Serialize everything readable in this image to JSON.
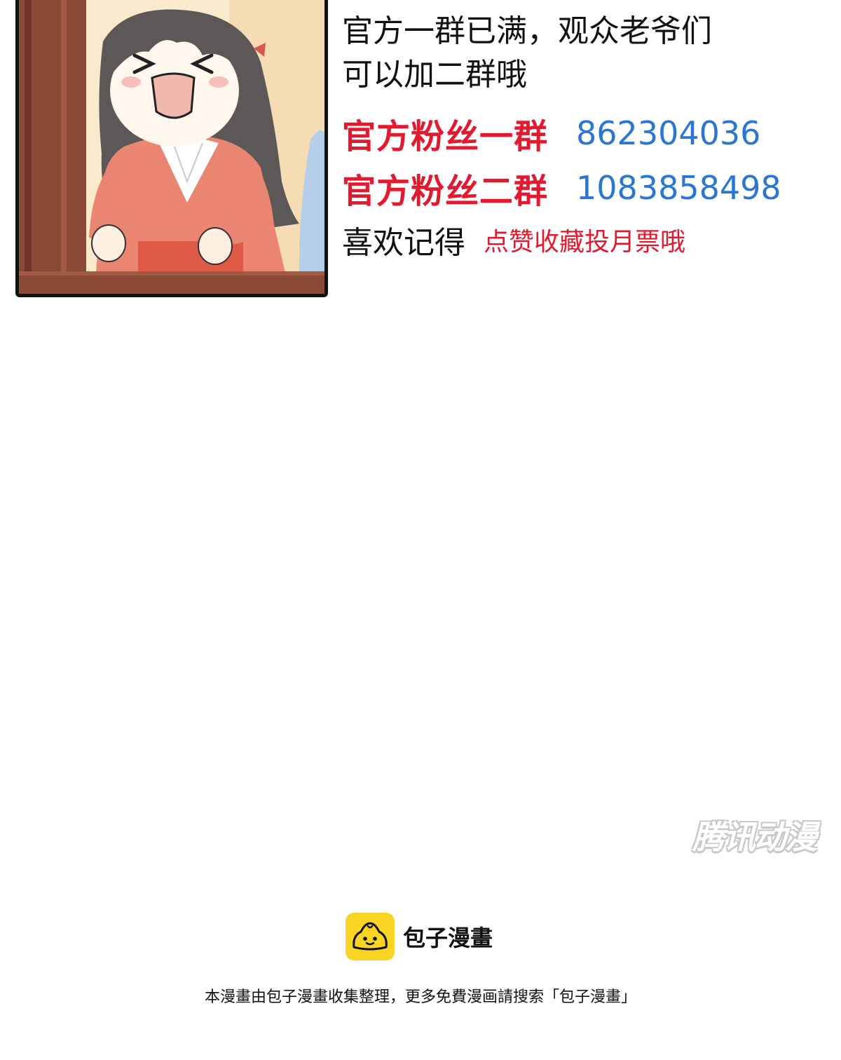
{
  "intro": {
    "line1": "官方一群已满，观众老爷们",
    "line2": "可以加二群哦"
  },
  "groups": [
    {
      "label": "官方粉丝一群",
      "number": "862304036"
    },
    {
      "label": "官方粉丝二群",
      "number": "1083858498"
    }
  ],
  "reminder": {
    "label": "喜欢记得",
    "action": "点赞收藏投月票哦"
  },
  "watermark": "腾讯动漫",
  "brand": {
    "icon": "bun-face-icon",
    "name": "包子漫畫",
    "color": "#f9d423"
  },
  "notice": "本漫畫由包子漫畫收集整理，更多免費漫画請搜索「包子漫畫」",
  "colors": {
    "accent_red": "#e3192f",
    "link_blue": "#2a76d2"
  }
}
